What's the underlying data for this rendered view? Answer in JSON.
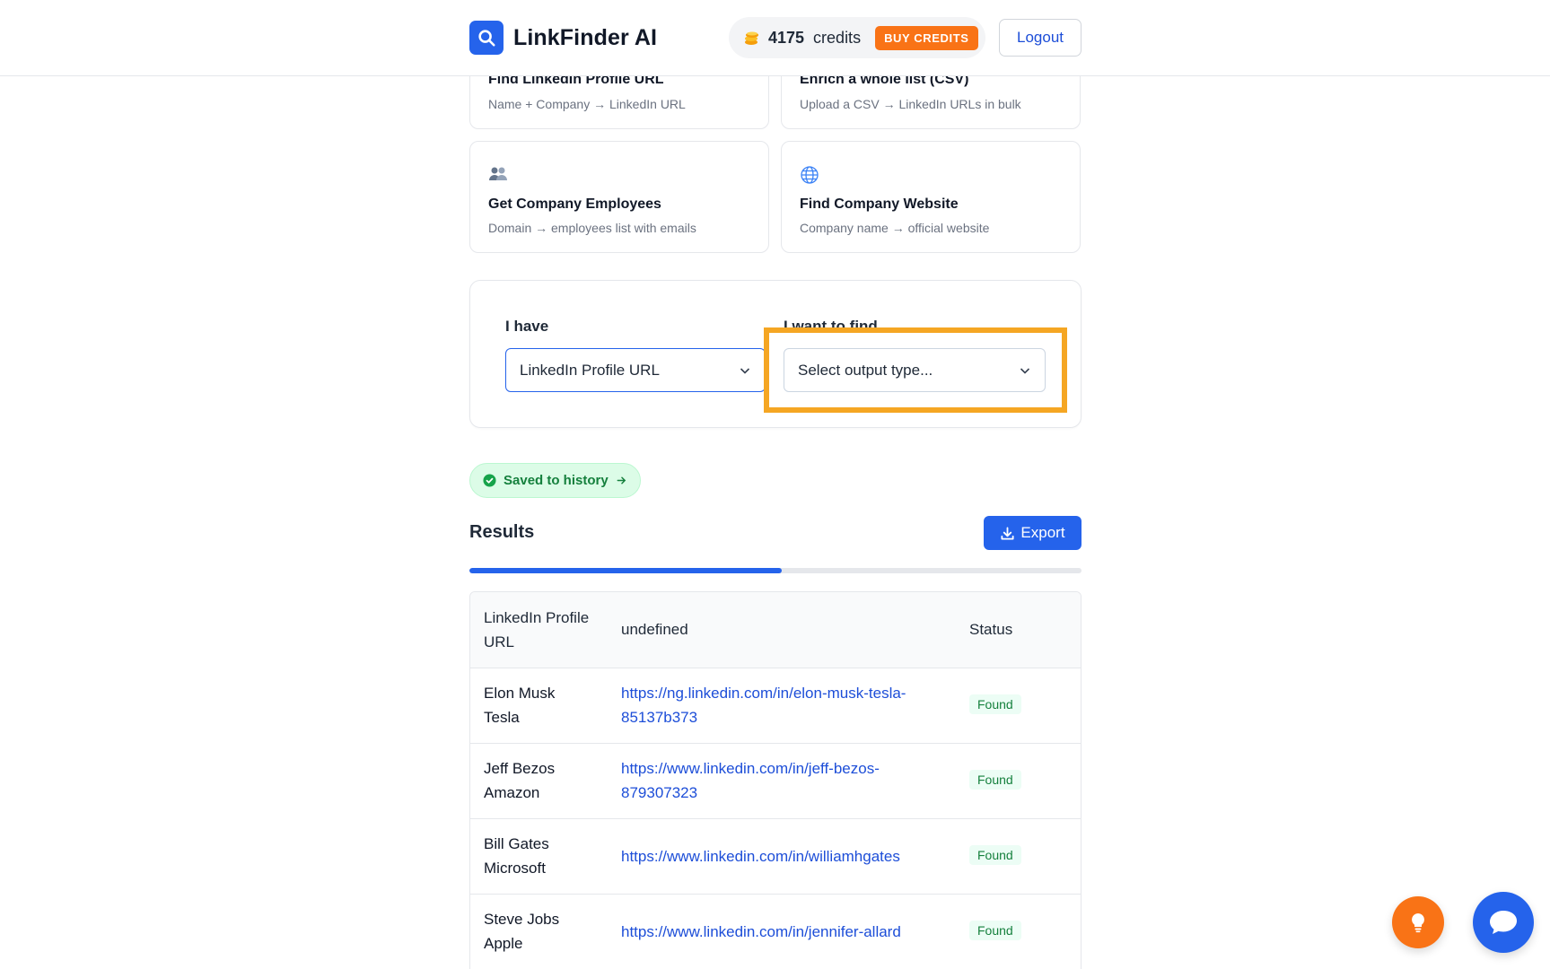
{
  "header": {
    "app_name": "LinkFinder AI",
    "credits_count": "4175",
    "credits_label": "credits",
    "buy_credits_label": "BUY CREDITS",
    "logout_label": "Logout"
  },
  "cards": [
    {
      "title": "Find LinkedIn Profile URL",
      "desc": "Name + Company → LinkedIn URL"
    },
    {
      "title": "Enrich a whole list (CSV)",
      "desc": "Upload a CSV → LinkedIn URLs in bulk"
    },
    {
      "title": "Get Company Employees",
      "desc": "Domain → employees list with emails",
      "icon": "people-icon"
    },
    {
      "title": "Find Company Website",
      "desc": "Company name → official website",
      "icon": "globe-icon"
    }
  ],
  "form": {
    "have_label": "I have",
    "have_value": "LinkedIn Profile URL",
    "want_label": "I want to find",
    "want_placeholder": "Select output type..."
  },
  "saved_badge": "Saved to history",
  "results": {
    "title": "Results",
    "export_label": "Export",
    "progress_fraction": 0.51,
    "columns": [
      "LinkedIn Profile URL",
      "undefined",
      "Status"
    ],
    "rows": [
      {
        "name": "Elon Musk",
        "company": "Tesla",
        "url": "https://ng.linkedin.com/in/elon-musk-tesla-85137b373",
        "status": "Found"
      },
      {
        "name": "Jeff Bezos",
        "company": "Amazon",
        "url": "https://www.linkedin.com/in/jeff-bezos-879307323",
        "status": "Found"
      },
      {
        "name": "Bill Gates",
        "company": "Microsoft",
        "url": "https://www.linkedin.com/in/williamhgates",
        "status": "Found"
      },
      {
        "name": "Steve Jobs",
        "company": "Apple",
        "url": "https://www.linkedin.com/in/jennifer-allard",
        "status": "Found"
      }
    ]
  },
  "colors": {
    "primary": "#2563eb",
    "accent": "#f97316",
    "highlight": "#f5a623",
    "success": "#15803d"
  }
}
